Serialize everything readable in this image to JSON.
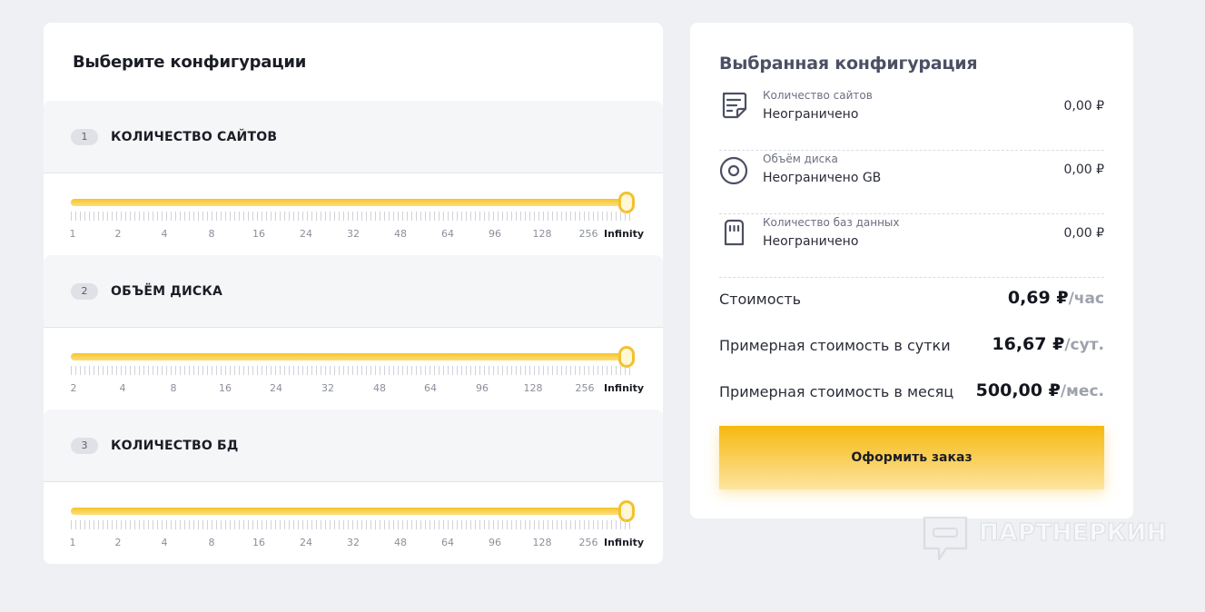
{
  "config": {
    "title": "Выберите конфигурации",
    "sections": [
      {
        "number": "1",
        "label": "КОЛИЧЕСТВО САЙТОВ",
        "ticks": [
          "1",
          "2",
          "4",
          "8",
          "16",
          "24",
          "32",
          "48",
          "64",
          "96",
          "128",
          "256",
          "Infinity"
        ],
        "selected": "Infinity"
      },
      {
        "number": "2",
        "label": "ОБЪЁМ ДИСКА",
        "ticks": [
          "2",
          "4",
          "8",
          "16",
          "24",
          "32",
          "48",
          "64",
          "96",
          "128",
          "256",
          "Infinity"
        ],
        "selected": "Infinity"
      },
      {
        "number": "3",
        "label": "КОЛИЧЕСТВО БД",
        "ticks": [
          "1",
          "2",
          "4",
          "8",
          "16",
          "24",
          "32",
          "48",
          "64",
          "96",
          "128",
          "256",
          "Infinity"
        ],
        "selected": "Infinity"
      }
    ]
  },
  "summary": {
    "title": "Выбранная конфигурация",
    "items": [
      {
        "icon": "sites-document-icon",
        "label": "Количество сайтов",
        "value": "Неограничено",
        "price": "0,00 ₽"
      },
      {
        "icon": "disk-icon",
        "label": "Объём диска",
        "value": "Неограничено GB",
        "price": "0,00 ₽"
      },
      {
        "icon": "database-icon",
        "label": "Количество баз данных",
        "value": "Неограничено",
        "price": "0,00 ₽"
      }
    ],
    "costs": [
      {
        "label": "Стоимость",
        "amount": "0,69 ₽",
        "unit": "/час"
      },
      {
        "label": "Примерная стоимость в сутки",
        "amount": "16,67 ₽",
        "unit": "/сут."
      },
      {
        "label": "Примерная стоимость в месяц",
        "amount": "500,00 ₽",
        "unit": "/мес."
      }
    ],
    "order_button": "Оформить заказ"
  },
  "watermark": {
    "text": "ПАРТНЕРКИН",
    "icon": "partnerkin-logo-icon"
  },
  "colors": {
    "accent": "#f6b90f",
    "page_bg": "#eff0f3",
    "card_bg": "#ffffff",
    "section_bg": "#f5f6f8",
    "summary_title": "#4c5064"
  }
}
